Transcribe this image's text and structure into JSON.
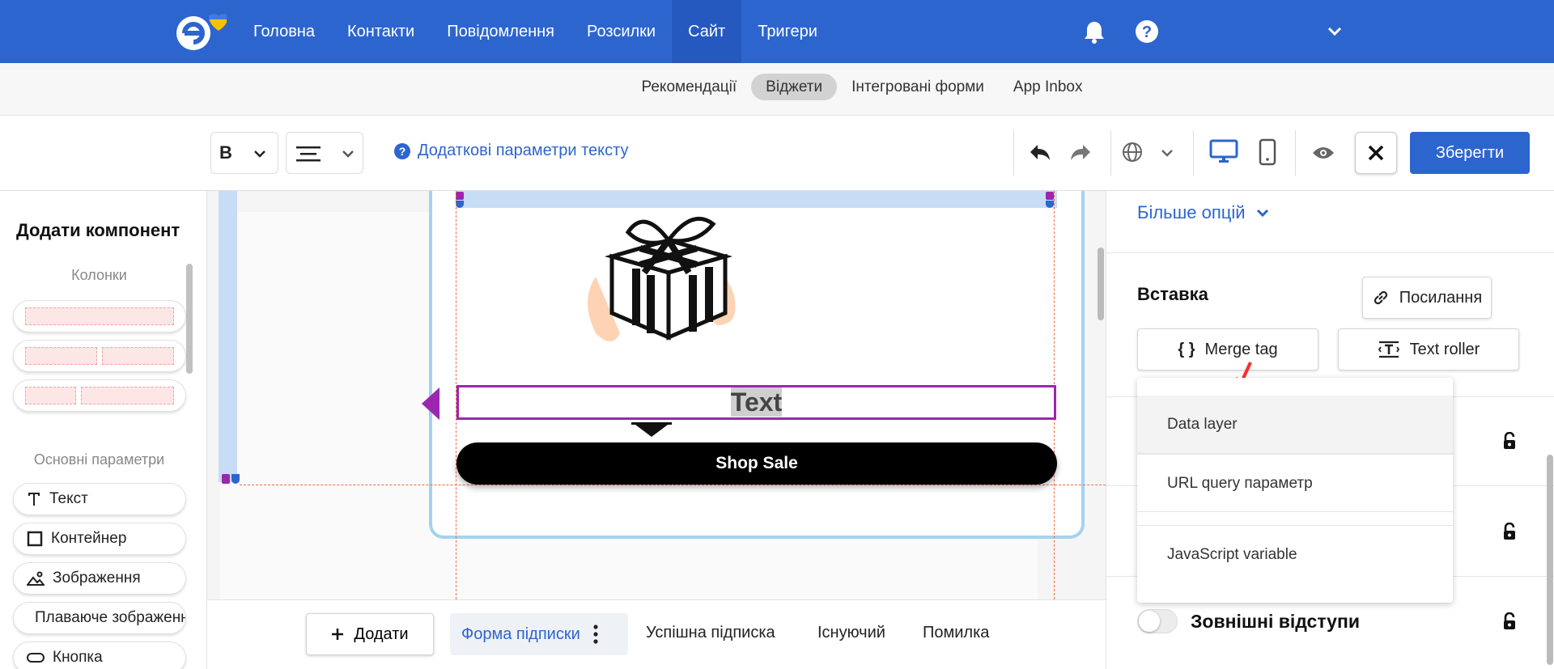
{
  "nav": {
    "items": [
      {
        "label": "Головна",
        "active": false
      },
      {
        "label": "Контакти",
        "active": false
      },
      {
        "label": "Повідомлення",
        "active": false
      },
      {
        "label": "Розсилки",
        "active": false
      },
      {
        "label": "Сайт",
        "active": true
      },
      {
        "label": "Тригери",
        "active": false
      }
    ],
    "icons": [
      "bell-icon",
      "help-icon",
      "chevron-down-icon"
    ]
  },
  "subnav": {
    "items": [
      {
        "label": "Рекомендації",
        "active": false
      },
      {
        "label": "Віджети",
        "active": true
      },
      {
        "label": "Інтегровані форми",
        "active": false
      },
      {
        "label": "App Inbox",
        "active": false
      }
    ]
  },
  "toolbar": {
    "bold_label": "B",
    "more_text_options": "Додаткові параметри тексту",
    "save_label": "Зберегти",
    "icons": [
      "undo-icon",
      "redo-icon",
      "globe-icon",
      "desktop-icon",
      "mobile-icon",
      "eye-icon",
      "close-icon"
    ]
  },
  "sidebar": {
    "title": "Додати компонент",
    "columns_header": "Колонки",
    "basic_header": "Основні параметри",
    "components": [
      {
        "label": "Текст",
        "icon": "text-icon"
      },
      {
        "label": "Контейнер",
        "icon": "container-icon"
      },
      {
        "label": "Зображення",
        "icon": "image-icon"
      },
      {
        "label": "Плаваюче зображення",
        "icon": "floating-image-icon"
      },
      {
        "label": "Кнопка",
        "icon": "button-icon"
      }
    ]
  },
  "canvas": {
    "text_block": "Text",
    "cta_button": "Shop Sale"
  },
  "bottom": {
    "add_label": "Додати",
    "tabs": [
      {
        "label": "Форма підписки",
        "active": true
      },
      {
        "label": "Успішна підписка",
        "active": false
      },
      {
        "label": "Існуючий",
        "active": false
      },
      {
        "label": "Помилка",
        "active": false
      }
    ]
  },
  "right": {
    "more_options": "Більше опцій",
    "insert_title": "Вставка",
    "link_btn": "Посилання",
    "merge_tag_btn": "Merge tag",
    "text_roller_btn": "Text roller",
    "dropdown": [
      "Data layer",
      "URL query параметр",
      "JavaScript variable"
    ],
    "margins_label": "Зовнішні відступи"
  },
  "colors": {
    "brand": "#2d65cf",
    "save": "#2d65cf",
    "selection": "#9b27b0",
    "accent_blue": "#2d65cf"
  }
}
